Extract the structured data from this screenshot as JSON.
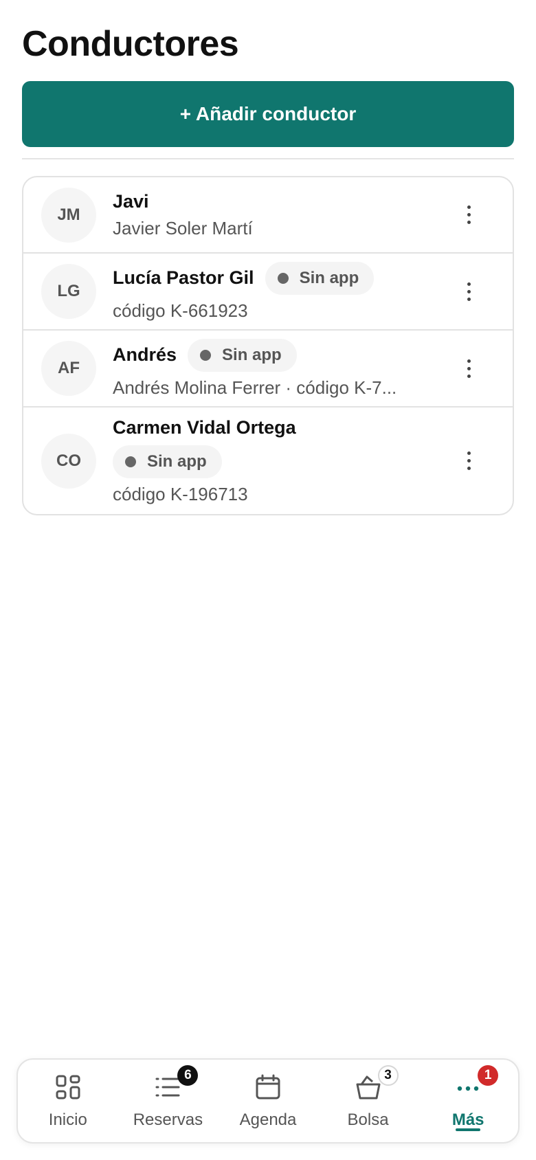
{
  "page": {
    "title": "Conductores"
  },
  "actions": {
    "add_driver_label": "+ Añadir conductor"
  },
  "drivers": [
    {
      "initials": "JM",
      "name": "Javi",
      "badge": "",
      "subline": "Javier Soler Martí"
    },
    {
      "initials": "LG",
      "name": "Lucía Pastor Gil",
      "badge": "Sin app",
      "subline": "código K-661923"
    },
    {
      "initials": "AF",
      "name": "Andrés",
      "badge": "Sin app",
      "subline": "Andrés Molina Ferrer · código K-7..."
    },
    {
      "initials": "CO",
      "name": "Carmen Vidal Ortega",
      "badge": "Sin app",
      "subline": "código K-196713"
    }
  ],
  "nav": {
    "items": [
      {
        "label": "Inicio",
        "icon": "grid-icon",
        "badge": ""
      },
      {
        "label": "Reservas",
        "icon": "list-icon",
        "badge": "6"
      },
      {
        "label": "Agenda",
        "icon": "calendar-icon",
        "badge": ""
      },
      {
        "label": "Bolsa",
        "icon": "basket-icon",
        "badge": "3"
      },
      {
        "label": "Más",
        "icon": "more-dots-icon",
        "badge": "1"
      }
    ],
    "active": "Más"
  },
  "colors": {
    "accent": "#10766e",
    "alert": "#d12a2a",
    "text": "#111111",
    "muted": "#555555"
  }
}
